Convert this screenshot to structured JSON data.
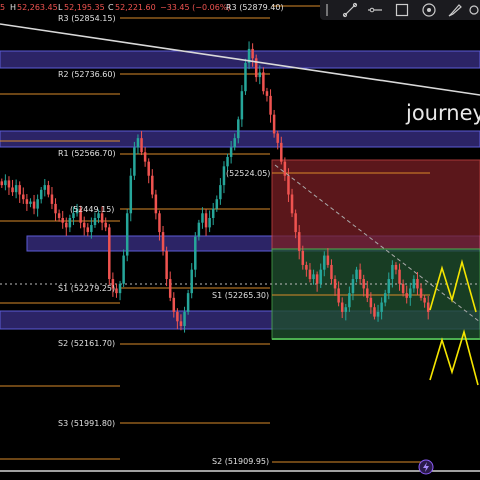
{
  "ohlc": {
    "high_label": "H",
    "high": "52,263.45",
    "low_label": "L",
    "low": "52,195.35",
    "close_label": "C",
    "close": "52,221.60",
    "change": "−33.45 (−0.06%)",
    "left_fragment": "5",
    "tail_fragment": "R3 (52879.40)"
  },
  "watermark": "journey",
  "toolbar": {
    "icons": [
      "cursor-icon",
      "trendline-icon",
      "horizontal-line-icon",
      "rectangle-icon",
      "target-icon",
      "brush-icon",
      "settings-icon"
    ]
  },
  "colors": {
    "background": "#000000",
    "up_candle": "#26a69a",
    "down_candle": "#ef5350",
    "level_line": "#d98a2a",
    "zone_border": "#5b5bd6",
    "zone_fill": "#2c2466",
    "short_zone": "#7a1f24",
    "long_zone": "#1f4d2e",
    "forecast": "#f5e500",
    "trendline": "#d9d9d9"
  },
  "chart_data": {
    "type": "candlestick",
    "title": "",
    "levels": [
      {
        "label": "R3 (52854.15)",
        "price": 52854.15
      },
      {
        "label": "R2 (52736.60)",
        "price": 52736.6
      },
      {
        "label": "R1 (52566.70)",
        "price": 52566.7
      },
      {
        "label": "(52524.05)",
        "price": 52524.05
      },
      {
        "label": "(52449.15)",
        "price": 52449.15
      },
      {
        "label": "S1 (52279.25)",
        "price": 52279.25
      },
      {
        "label": "S1 (52265.30)",
        "price": 52265.3
      },
      {
        "label": "S2 (52161.70)",
        "price": 52161.7
      },
      {
        "label": "S3 (51991.80)",
        "price": 51991.8
      },
      {
        "label": "S2 (51909.95)",
        "price": 51909.95
      },
      {
        "label": "R3 (52879.40)",
        "price": 52879.4
      }
    ],
    "candle_closes": [
      52500,
      52510,
      52495,
      52485,
      52500,
      52480,
      52470,
      52460,
      52465,
      52450,
      52470,
      52490,
      52500,
      52480,
      52460,
      52440,
      52430,
      52420,
      52410,
      52430,
      52440,
      52450,
      52420,
      52410,
      52400,
      52415,
      52430,
      52440,
      52420,
      52410,
      52300,
      52280,
      52270,
      52290,
      52350,
      52440,
      52520,
      52580,
      52600,
      52570,
      52550,
      52520,
      52480,
      52440,
      52400,
      52360,
      52300,
      52260,
      52230,
      52210,
      52200,
      52230,
      52270,
      52320,
      52390,
      52420,
      52440,
      52410,
      52430,
      52450,
      52470,
      52500,
      52540,
      52560,
      52580,
      52600,
      52640,
      52700,
      52760,
      52790,
      52770,
      52730,
      52740,
      52700,
      52690,
      52650,
      52610,
      52590,
      52550,
      52520,
      52480,
      52440,
      52400,
      52360,
      52330,
      52320,
      52300,
      52310,
      52290,
      52320,
      52350,
      52330,
      52300,
      52280,
      52250,
      52230,
      52240,
      52270,
      52300,
      52320,
      52300,
      52280,
      52260,
      52240,
      52220,
      52230,
      52250,
      52270,
      52300,
      52330,
      52320,
      52290,
      52270,
      52260,
      52280,
      52300,
      52280,
      52260,
      52250,
      52230
    ]
  }
}
